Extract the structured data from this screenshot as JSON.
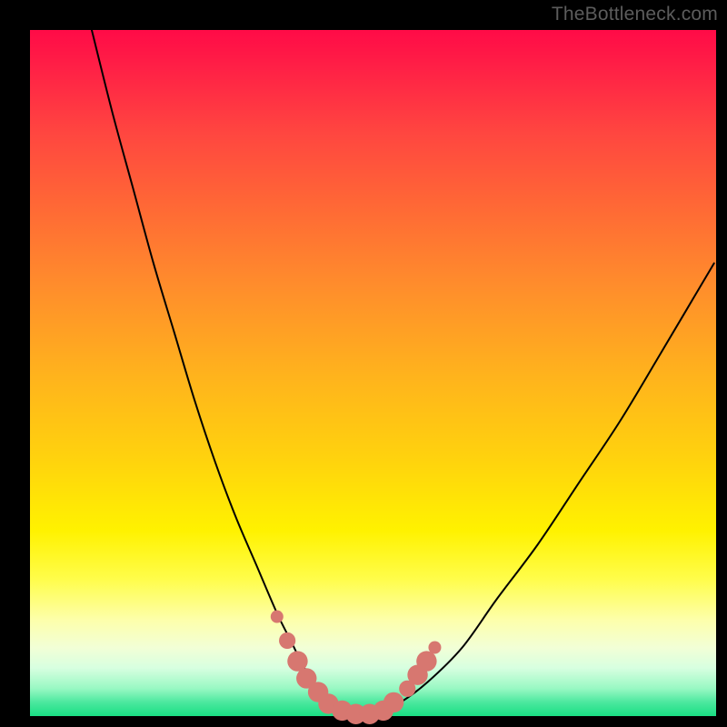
{
  "watermark": "TheBottleneck.com",
  "chart_data": {
    "type": "line",
    "title": "",
    "xlabel": "",
    "ylabel": "",
    "xlim": [
      0,
      100
    ],
    "ylim": [
      0,
      100
    ],
    "series": [
      {
        "name": "bottleneck-curve",
        "x": [
          9,
          12,
          15,
          18,
          21,
          24,
          27,
          30,
          33,
          36,
          38,
          40,
          42,
          44,
          47,
          50,
          54,
          58,
          63,
          68,
          74,
          80,
          86,
          92,
          99.7
        ],
        "y": [
          100,
          88,
          77,
          66,
          56,
          46,
          37,
          29,
          22,
          15,
          11,
          7,
          4,
          2,
          0,
          0,
          2,
          5,
          10,
          17,
          25,
          34,
          43,
          53,
          66
        ]
      }
    ],
    "markers": {
      "name": "highlight-dots",
      "color": "#d77770",
      "points": [
        {
          "x": 36.0,
          "y": 14.5,
          "r": 1.0
        },
        {
          "x": 37.5,
          "y": 11.0,
          "r": 1.3
        },
        {
          "x": 39.0,
          "y": 8.0,
          "r": 1.6
        },
        {
          "x": 40.3,
          "y": 5.5,
          "r": 1.6
        },
        {
          "x": 42.0,
          "y": 3.5,
          "r": 1.6
        },
        {
          "x": 43.5,
          "y": 1.8,
          "r": 1.6
        },
        {
          "x": 45.5,
          "y": 0.8,
          "r": 1.6
        },
        {
          "x": 47.5,
          "y": 0.3,
          "r": 1.6
        },
        {
          "x": 49.5,
          "y": 0.3,
          "r": 1.6
        },
        {
          "x": 51.5,
          "y": 0.8,
          "r": 1.6
        },
        {
          "x": 53.0,
          "y": 2.0,
          "r": 1.6
        },
        {
          "x": 55.0,
          "y": 4.0,
          "r": 1.3
        },
        {
          "x": 56.5,
          "y": 6.0,
          "r": 1.6
        },
        {
          "x": 57.8,
          "y": 8.0,
          "r": 1.6
        },
        {
          "x": 59.0,
          "y": 10.0,
          "r": 1.0
        }
      ]
    },
    "gradient_stops": [
      {
        "pos": 0,
        "color": "#ff0b47"
      },
      {
        "pos": 15,
        "color": "#ff4640"
      },
      {
        "pos": 37,
        "color": "#ff8c2c"
      },
      {
        "pos": 62,
        "color": "#ffd10e"
      },
      {
        "pos": 80,
        "color": "#fffd4a"
      },
      {
        "pos": 93,
        "color": "#d7ffe0"
      },
      {
        "pos": 100,
        "color": "#19de84"
      }
    ]
  }
}
